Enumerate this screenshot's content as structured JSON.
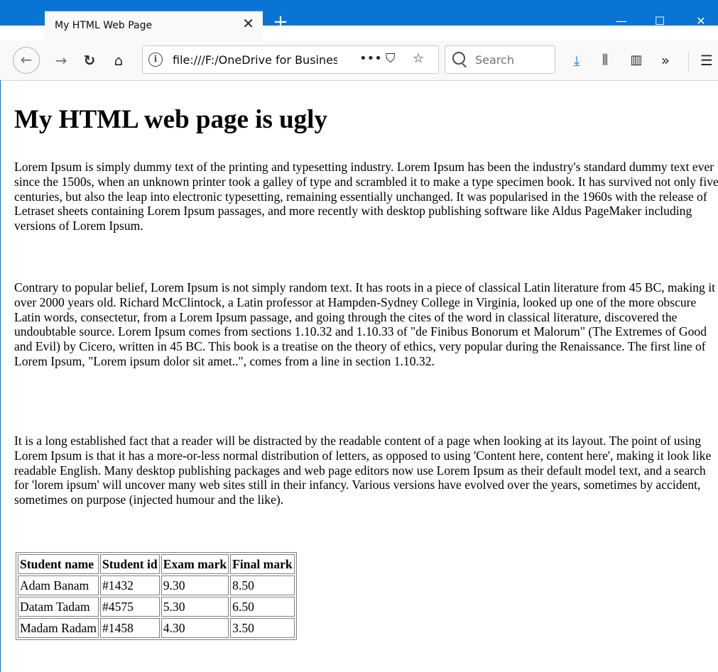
{
  "browser": {
    "tab_title": "My HTML Web Page",
    "tab_close": "✕",
    "new_tab": "+",
    "minimize": "—",
    "maximize": "☐",
    "close": "✕",
    "url": "file:///F:/OneDrive for Business",
    "url_actions": [
      "•••",
      "⛉",
      "☆"
    ],
    "search_placeholder": "Search",
    "toolbar_icons": [
      "back-arrow-icon",
      "forward-arrow-icon",
      "reload-icon",
      "home-icon",
      "download-icon",
      "library-icon",
      "sidebar-icon",
      "overflow-icon",
      "menu-icon"
    ],
    "accent_color": "#0a74d4"
  },
  "page": {
    "heading": "My HTML web page is ugly",
    "paragraphs": [
      "Lorem Ipsum is simply dummy text of the printing and typesetting industry. Lorem Ipsum has been the industry's standard dummy text ever since the 1500s, when an unknown printer took a galley of type and scrambled it to make a type specimen book. It has survived not only five centuries, but also the leap into electronic typesetting, remaining essentially unchanged. It was popularised in the 1960s with the release of Letraset sheets containing Lorem Ipsum passages, and more recently with desktop publishing software like Aldus PageMaker including versions of Lorem Ipsum.",
      "Contrary to popular belief, Lorem Ipsum is not simply random text. It has roots in a piece of classical Latin literature from 45 BC, making it over 2000 years old. Richard McClintock, a Latin professor at Hampden-Sydney College in Virginia, looked up one of the more obscure Latin words, consectetur, from a Lorem Ipsum passage, and going through the cites of the word in classical literature, discovered the undoubtable source. Lorem Ipsum comes from sections 1.10.32 and 1.10.33 of \"de Finibus Bonorum et Malorum\" (The Extremes of Good and Evil) by Cicero, written in 45 BC. This book is a treatise on the theory of ethics, very popular during the Renaissance. The first line of Lorem Ipsum, \"Lorem ipsum dolor sit amet..\", comes from a line in section 1.10.32.",
      "It is a long established fact that a reader will be distracted by the readable content of a page when looking at its layout. The point of using Lorem Ipsum is that it has a more-or-less normal distribution of letters, as opposed to using 'Content here, content here', making it look like readable English. Many desktop publishing packages and web page editors now use Lorem Ipsum as their default model text, and a search for 'lorem ipsum' will uncover many web sites still in their infancy. Various versions have evolved over the years, sometimes by accident, sometimes on purpose (injected humour and the like)."
    ],
    "table": {
      "headers": [
        "Student name",
        "Student id",
        "Exam mark",
        "Final mark"
      ],
      "rows": [
        [
          "Adam Banam",
          "#1432",
          "9.30",
          "8.50"
        ],
        [
          "Datam Tadam",
          "#4575",
          "5.30",
          "6.50"
        ],
        [
          "Madam Radam",
          "#1458",
          "4.30",
          "3.50"
        ]
      ]
    }
  }
}
